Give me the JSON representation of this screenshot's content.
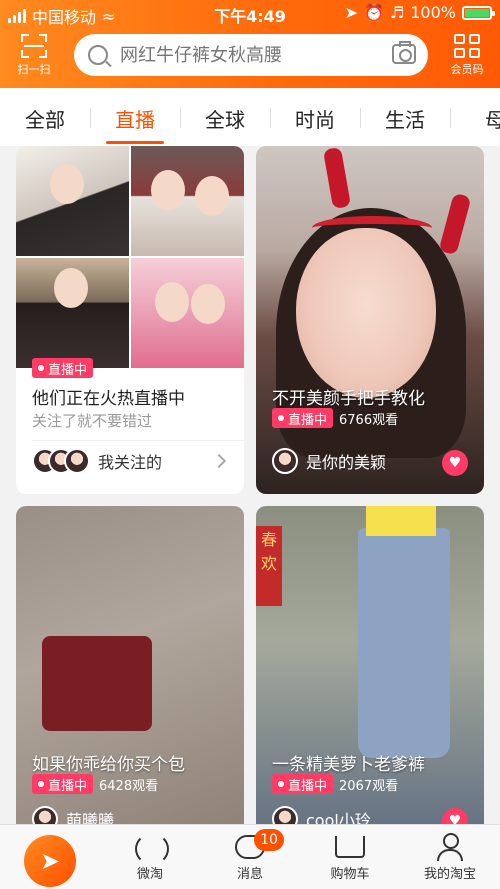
{
  "status_bar": {
    "carrier": "中国移动",
    "time": "下午4:49",
    "battery": "100%",
    "battery_level": 1.0
  },
  "header": {
    "scan_label": "扫一扫",
    "search_placeholder": "网红牛仔裤女秋高腰",
    "member_label": "会员码"
  },
  "tabs": [
    "全部",
    "直播",
    "全球",
    "时尚",
    "生活",
    "母"
  ],
  "active_tab": "直播",
  "feed": {
    "live_badge": "直播中",
    "card1": {
      "title": "他们正在火热直播中",
      "subtitle": "关注了就不要错过",
      "follow_label": "我关注的"
    },
    "card2": {
      "title": "不开美颜手把手教化",
      "viewers": "6766观看",
      "anchor": "是你的美颖"
    },
    "card3": {
      "title": "如果你乖给你买个包",
      "viewers": "6428观看",
      "anchor": "萌曦曦"
    },
    "card4": {
      "title": "一条精美萝卜老爹裤",
      "viewers": "2067观看",
      "anchor": "cool小玲",
      "sign_text": "春欢"
    }
  },
  "bottom_nav": {
    "weitao": "微淘",
    "messages": "消息",
    "messages_badge": "10",
    "cart": "购物车",
    "me": "我的淘宝"
  },
  "colors": {
    "brand_orange": "#ff5000",
    "live_pink": "#ff3b66"
  }
}
